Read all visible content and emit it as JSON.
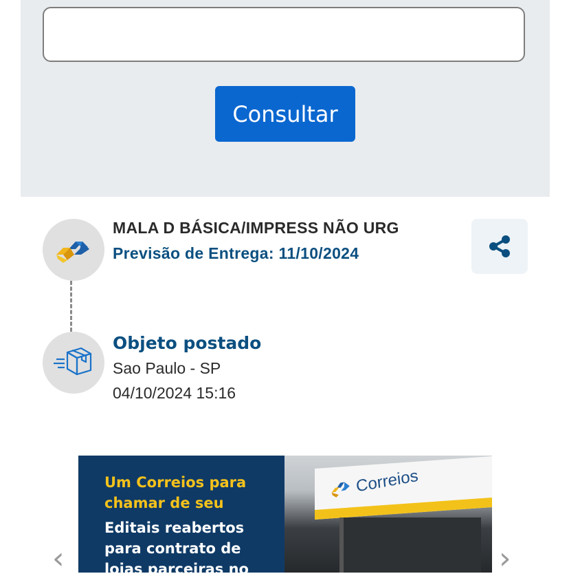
{
  "search": {
    "input_value": "",
    "button_label": "Consultar"
  },
  "shipment": {
    "product_name": "MALA D BÁSICA/IMPRESS NÃO URG",
    "forecast": "Previsão de Entrega: 11/10/2024",
    "logo_icon": "correios-logo-icon",
    "share_icon": "share-icon"
  },
  "events": [
    {
      "icon": "package-icon",
      "title": "Objeto postado",
      "location": "Sao Paulo - SP",
      "datetime": "04/10/2024 15:16"
    }
  ],
  "banner": {
    "headline": "Um Correios para chamar de seu",
    "body": "Editais reabertos\npara contrato de\nlojas parceiras no",
    "sign_text": "Correios"
  },
  "carousel": {
    "prev_icon": "chevron-left-icon",
    "next_icon": "chevron-right-icon",
    "prev_glyph": "‹",
    "next_glyph": "›"
  },
  "colors": {
    "primary_button": "#0b67d0",
    "accent_text": "#0b4f80",
    "brand_yellow": "#f5c21b",
    "panel_bg": "#e9ecef"
  }
}
